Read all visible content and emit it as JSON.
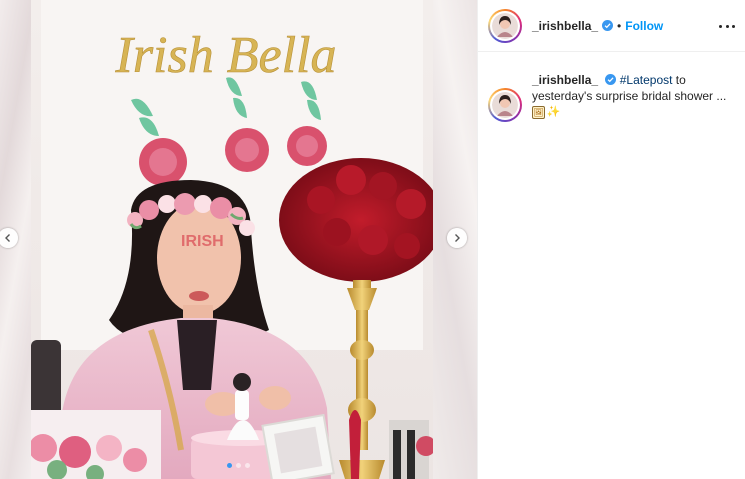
{
  "post": {
    "username": "_irishbella_",
    "follow_label": "Follow",
    "separator": "•",
    "caption": {
      "hashtag": "#Latepost",
      "text_after_hashtag": " to yesterday's surprise bridal shower ...",
      "emojis": [
        "🖼",
        "✨"
      ]
    },
    "photo_banner_text": "Irish Bella",
    "carousel": {
      "total": 3,
      "active": 1
    }
  },
  "colors": {
    "follow": "#0095f6",
    "verified": "#3897f0",
    "hashtag": "#00376b",
    "carousel_active": "#3897f0"
  },
  "icons": {
    "verified": "verified-badge-icon",
    "more": "more-options-icon",
    "prev": "chevron-left-icon",
    "next": "chevron-right-icon"
  }
}
